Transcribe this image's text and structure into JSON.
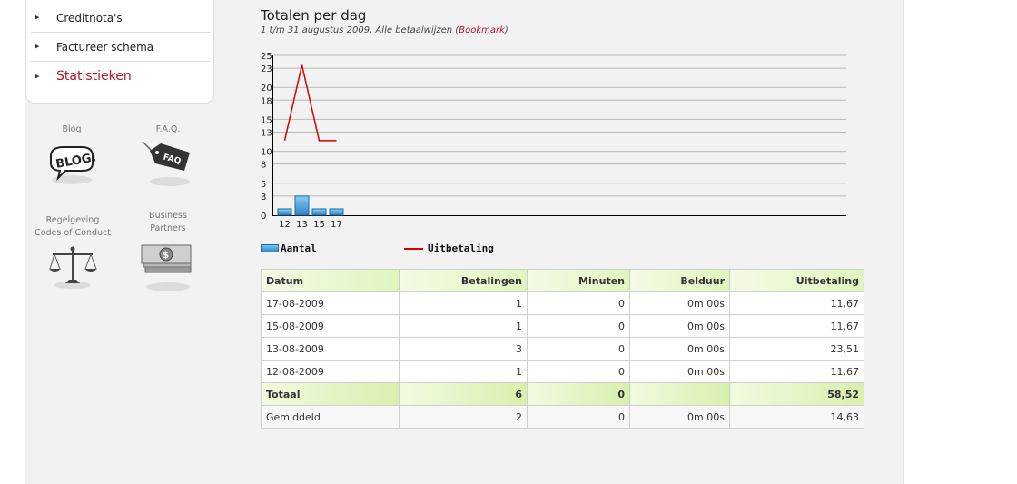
{
  "sidebar": {
    "menu": [
      {
        "label": "Creditnota's",
        "active": false
      },
      {
        "label": "Factureer schema",
        "active": false
      },
      {
        "label": "Statistieken",
        "active": true
      }
    ],
    "links": [
      {
        "label": "Blog",
        "icon": "blog-icon"
      },
      {
        "label": "F.A.Q.",
        "icon": "faq-tag-icon"
      },
      {
        "label_line1": "Regelgeving",
        "label_line2": "Codes of Conduct",
        "icon": "scales-icon"
      },
      {
        "label_line1": "Business",
        "label_line2": "Partners",
        "icon": "money-icon"
      }
    ]
  },
  "main": {
    "title": "Totalen per dag",
    "subtitle_prefix": "1 t/m 31 augustus 2009, Alle betaalwijzen (",
    "subtitle_link": "Bookmark",
    "subtitle_suffix": ")"
  },
  "chart_data": {
    "type": "bar+line",
    "categories": [
      "12",
      "13",
      "15",
      "17"
    ],
    "y_ticks": [
      "0",
      "3",
      "5",
      "8",
      "10",
      "13",
      "15",
      "18",
      "20",
      "23",
      "25"
    ],
    "ylim": [
      0,
      25
    ],
    "series": [
      {
        "name": "Aantal",
        "type": "bar",
        "values": [
          1,
          3,
          1,
          1
        ],
        "color": "#3a9ad9"
      },
      {
        "name": "Uitbetaling",
        "type": "line",
        "values": [
          11.67,
          23.51,
          11.67,
          11.67
        ],
        "color": "#d40000"
      }
    ],
    "grid": true,
    "legend_position": "bottom"
  },
  "table": {
    "headers": [
      "Datum",
      "Betalingen",
      "Minuten",
      "Belduur",
      "Uitbetaling"
    ],
    "rows": [
      [
        "17-08-2009",
        "1",
        "0",
        "0m 00s",
        "11,67"
      ],
      [
        "15-08-2009",
        "1",
        "0",
        "0m 00s",
        "11,67"
      ],
      [
        "13-08-2009",
        "3",
        "0",
        "0m 00s",
        "23,51"
      ],
      [
        "12-08-2009",
        "1",
        "0",
        "0m 00s",
        "11,67"
      ]
    ],
    "total": [
      "Totaal",
      "6",
      "0",
      "",
      "58,52"
    ],
    "average": [
      "Gemiddeld",
      "2",
      "0",
      "0m 00s",
      "14,63"
    ]
  }
}
